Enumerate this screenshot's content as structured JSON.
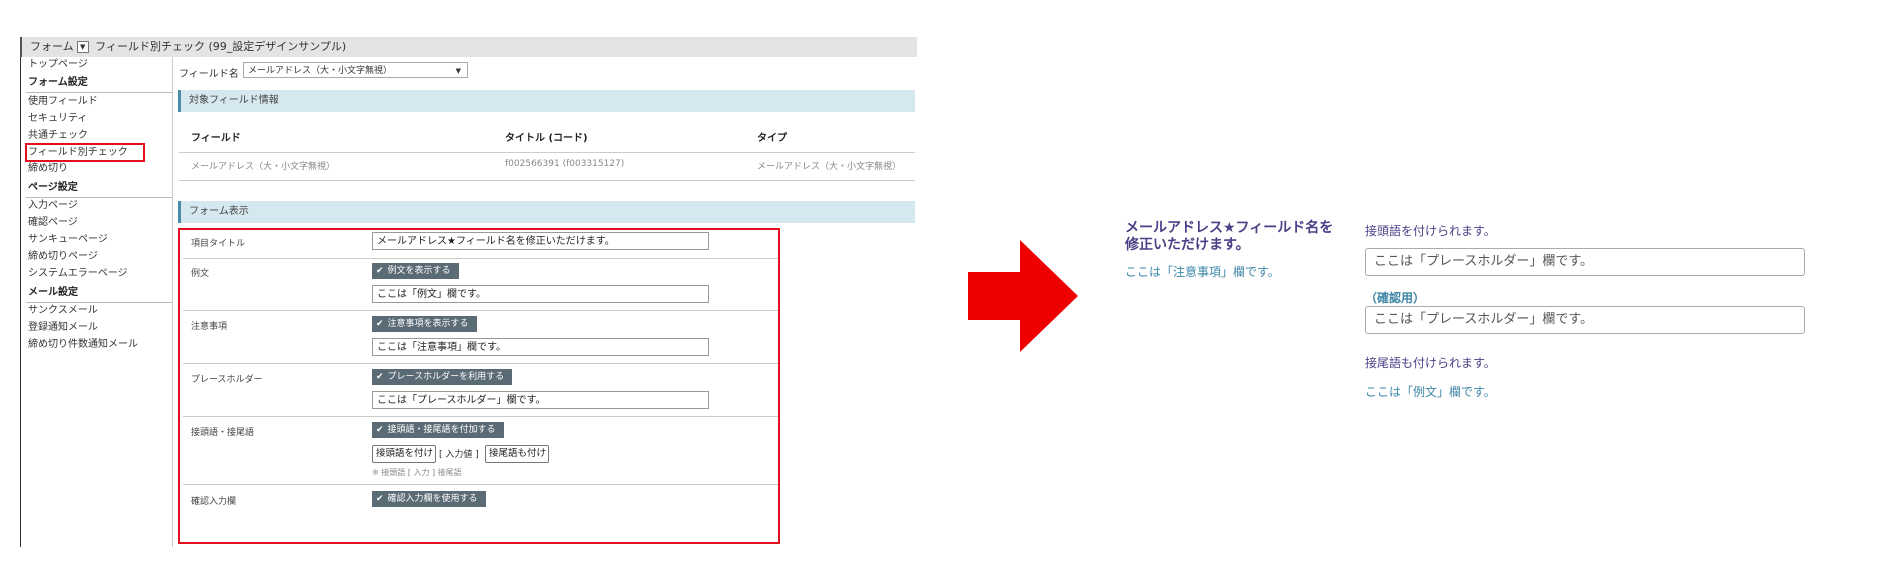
{
  "topbar": {
    "form_label": "フォーム",
    "dropdown_icon": "chevron-down-icon",
    "page_title": "フィールド別チェック (99_設定デザインサンプル)"
  },
  "sidebar": {
    "top_page": "トップページ",
    "form_settings_heading": "フォーム設定",
    "form_items": [
      "使用フィールド",
      "セキュリティ",
      "共通チェック",
      "フィールド別チェック",
      "締め切り"
    ],
    "page_settings_heading": "ページ設定",
    "page_items": [
      "入力ページ",
      "確認ページ",
      "サンキューページ",
      "締め切りページ",
      "システムエラーページ"
    ],
    "mail_settings_heading": "メール設定",
    "mail_items": [
      "サンクスメール",
      "登録通知メール",
      "締め切り件数通知メール"
    ]
  },
  "field_name": {
    "label": "フィールド名",
    "selected": "メールアドレス（大・小文字無視）"
  },
  "target_section": {
    "title": "対象フィールド情報",
    "headers": [
      "フィールド",
      "タイトル (コード)",
      "タイプ"
    ],
    "row": [
      "メールアドレス（大・小文字無視）",
      "f002566391 (f003315127)",
      "メールアドレス（大・小文字無視）"
    ]
  },
  "form_display": {
    "title": "フォーム表示",
    "item_title_label": "項目タイトル",
    "item_title_value": "メールアドレス★フィールド名を修正いただけます。",
    "example_label": "例文",
    "example_checkbox": "例文を表示する",
    "example_value": "ここは「例文」欄です。",
    "note_label": "注意事項",
    "note_checkbox": "注意事項を表示する",
    "note_value": "ここは「注意事項」欄です。",
    "placeholder_label": "プレースホルダー",
    "placeholder_checkbox": "プレースホルダーを利用する",
    "placeholder_value": "ここは「プレースホルダー」欄です。",
    "affix_label": "接頭語・接尾語",
    "affix_checkbox": "接頭語・接尾語を付加する",
    "prefix_value": "接頭語を付け",
    "input_value_label": "[ 入力値 ]",
    "suffix_value": "接尾語も付け",
    "affix_hint": "※ 接頭語 [ 入力 ] 接尾語",
    "confirm_label": "確認入力欄",
    "confirm_checkbox": "確認入力欄を使用する"
  },
  "preview": {
    "title": "メールアドレス★フィールド名を修正いただけます。",
    "note": "ここは「注意事項」欄です。",
    "prefix": "接頭語を付けられます。",
    "placeholder": "ここは「プレースホルダー」欄です。",
    "confirm_label": "（確認用）",
    "suffix": "接尾語も付けられます。",
    "example": "ここは「例文」欄です。"
  },
  "colors": {
    "highlight": "#e0101e",
    "arrow": "#ee0000",
    "section_bg": "#d5e8ef",
    "checkbox_bg": "#5a6b76",
    "preview_title": "#4b3f86",
    "preview_note": "#3d87a6"
  }
}
